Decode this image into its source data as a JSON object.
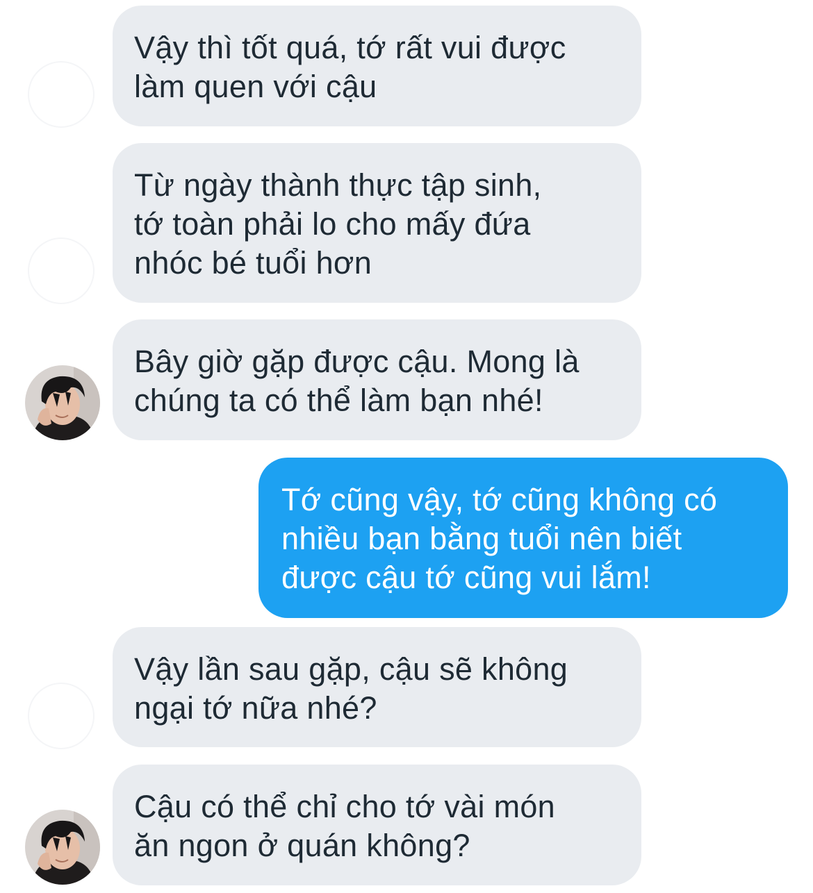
{
  "conversation": {
    "messages": [
      {
        "sender": "other",
        "text": "Vậy thì tốt quá, tớ rất vui được\nlàm quen với cậu"
      },
      {
        "sender": "other",
        "text": "Từ ngày thành thực tập sinh,\ntớ toàn phải lo cho mấy đứa\nnhóc bé tuổi hơn"
      },
      {
        "sender": "other",
        "text": "Bây giờ gặp được cậu. Mong là\nchúng ta có thể làm bạn nhé!"
      },
      {
        "sender": "me",
        "text": "Tớ cũng vậy, tớ cũng không có\nnhiều bạn bằng tuổi nên biết\nđược cậu tớ cũng vui lắm!"
      },
      {
        "sender": "other",
        "text": "Vậy lần sau gặp, cậu sẽ không\nngại tớ nữa nhé?"
      },
      {
        "sender": "other",
        "text": "Cậu có thể chỉ cho tớ vài món\năn ngon ở quán không?"
      }
    ]
  },
  "colors": {
    "incoming_bubble": "#e9ecf0",
    "incoming_text": "#1e2a34",
    "outgoing_bubble": "#1da1f2",
    "outgoing_text": "#ffffff"
  },
  "icons": {
    "avatar": "contact-avatar-photo"
  }
}
